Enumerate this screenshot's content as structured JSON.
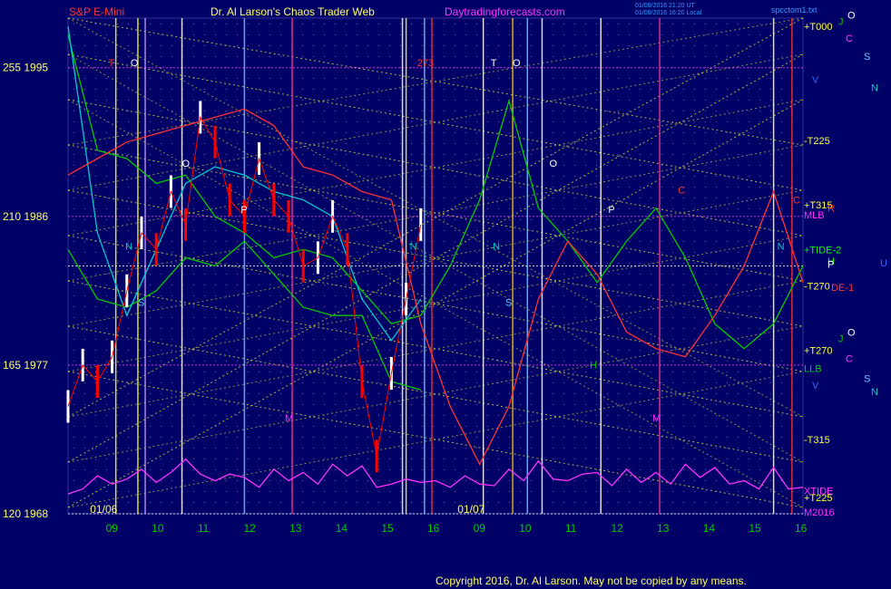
{
  "header": {
    "symbol": "S&P E-Mini",
    "title": "Dr. Al Larson's Chaos Trader Web",
    "site": "Daytradingforecasts.com",
    "stamp1": "01/08/2016 21:20 UT",
    "stamp2": "01/08/2016 16:20 Local",
    "chart_file": "spcctom1.txt"
  },
  "footer": {
    "copyright": "Copyright 2016, Dr. Al Larson. May not be copied by any means."
  },
  "colors": {
    "background": "#000066",
    "price_bar": "#ffffff",
    "price_down": "#ff0000",
    "green_line": "#00cc00",
    "cyan_line": "#00cccc",
    "red_line": "#ff3333",
    "magenta_line": "#ff33ff",
    "yellow_grid": "#ffff33"
  },
  "chart_data": {
    "type": "line",
    "title": "S&P E-Mini",
    "y_axis": {
      "ylim": [
        1968,
        1998
      ],
      "ticks": [
        {
          "price": 1995,
          "label": "255  1995"
        },
        {
          "price": 1986,
          "label": "210  1986"
        },
        {
          "price": 1977,
          "label": "165  1977"
        },
        {
          "price": 1968,
          "label": "120  1968"
        }
      ]
    },
    "x_axis": {
      "date_labels": [
        "01/06",
        "01/07"
      ],
      "hours_day1": [
        "09",
        "10",
        "11",
        "12",
        "13",
        "14",
        "15",
        "16"
      ],
      "hours_day2": [
        "09",
        "10",
        "11",
        "12",
        "13",
        "14",
        "15",
        "16"
      ]
    },
    "right_labels": [
      {
        "text": "+T000",
        "color": "#ffff33",
        "price": 1997.5
      },
      {
        "text": "J",
        "color": "#00cc00",
        "price": 1997.8
      },
      {
        "text": "O",
        "color": "#ffffff",
        "price": 1998.2
      },
      {
        "text": "C",
        "color": "#ff33ff",
        "price": 1996.8
      },
      {
        "text": "S",
        "color": "#66ccff",
        "price": 1995.7
      },
      {
        "text": "V",
        "color": "#3366ff",
        "price": 1994.3
      },
      {
        "text": "N",
        "color": "#00cccc",
        "price": 1993.8
      },
      {
        "text": "-T225",
        "color": "#ffff33",
        "price": 1990.6
      },
      {
        "text": "+T315",
        "color": "#ffff33",
        "price": 1986.7
      },
      {
        "text": "C",
        "color": "#ff3333",
        "price": 1987.0
      },
      {
        "text": "R",
        "color": "#ff3333",
        "price": 1986.5
      },
      {
        "text": "MLB",
        "color": "#ff33ff",
        "price": 1986.1
      },
      {
        "text": "+TIDE-2",
        "color": "#00ff00",
        "price": 1984.0
      },
      {
        "text": "H",
        "color": "#00ff00",
        "price": 1983.3
      },
      {
        "text": "P",
        "color": "#ffffff",
        "price": 1983.1
      },
      {
        "text": "U",
        "color": "#3366ff",
        "price": 1983.2
      },
      {
        "text": "-T270",
        "color": "#ffff33",
        "price": 1981.8
      },
      {
        "text": "DE-1",
        "color": "#ff3333",
        "price": 1981.7
      },
      {
        "text": "J",
        "color": "#00cc00",
        "price": 1978.6
      },
      {
        "text": "O",
        "color": "#ffffff",
        "price": 1979.0
      },
      {
        "text": "+T270",
        "color": "#ffff33",
        "price": 1977.9
      },
      {
        "text": "C",
        "color": "#ff33ff",
        "price": 1977.4
      },
      {
        "text": "LLB",
        "color": "#00cc00",
        "price": 1976.8
      },
      {
        "text": "S",
        "color": "#66ccff",
        "price": 1976.2
      },
      {
        "text": "V",
        "color": "#3366ff",
        "price": 1975.8
      },
      {
        "text": "N",
        "color": "#00cccc",
        "price": 1975.4
      },
      {
        "text": "-T315",
        "color": "#ffff33",
        "price": 1972.5
      },
      {
        "text": "XTIDE",
        "color": "#ff33ff",
        "price": 1969.4
      },
      {
        "text": "+T225",
        "color": "#ffff33",
        "price": 1969.0
      },
      {
        "text": "M2016",
        "color": "#ff33ff",
        "price": 1968.1
      }
    ],
    "in_chart_labels": [
      {
        "text": "T",
        "color": "#ff3333",
        "x": 0.055,
        "price": 1995.1
      },
      {
        "text": "O",
        "color": "#ffffff",
        "x": 0.085,
        "price": 1995.1
      },
      {
        "text": "273",
        "color": "#ff3333",
        "x": 0.475,
        "price": 1995.1
      },
      {
        "text": "T",
        "color": "#ffffff",
        "x": 0.575,
        "price": 1995.1
      },
      {
        "text": "O",
        "color": "#ffffff",
        "x": 0.605,
        "price": 1995.1
      },
      {
        "text": "O",
        "color": "#ffffff",
        "x": 0.155,
        "price": 1989.0
      },
      {
        "text": "O",
        "color": "#ffffff",
        "x": 0.655,
        "price": 1989.0
      },
      {
        "text": "P",
        "color": "#ffffff",
        "x": 0.235,
        "price": 1986.2
      },
      {
        "text": "P",
        "color": "#ffffff",
        "x": 0.735,
        "price": 1986.2
      },
      {
        "text": "N",
        "color": "#00cccc",
        "x": 0.078,
        "price": 1984.0
      },
      {
        "text": "N",
        "color": "#00cccc",
        "x": 0.465,
        "price": 1984.0
      },
      {
        "text": "N",
        "color": "#00cccc",
        "x": 0.578,
        "price": 1984.0
      },
      {
        "text": "N",
        "color": "#00cccc",
        "x": 0.965,
        "price": 1984.0
      },
      {
        "text": "S",
        "color": "#66ccff",
        "x": 0.095,
        "price": 1980.6
      },
      {
        "text": "S",
        "color": "#66ccff",
        "x": 0.595,
        "price": 1980.6
      },
      {
        "text": "M",
        "color": "#ff33ff",
        "x": 0.295,
        "price": 1973.6
      },
      {
        "text": "M",
        "color": "#ff33ff",
        "x": 0.795,
        "price": 1973.6
      },
      {
        "text": "H",
        "color": "#00cc00",
        "x": 0.71,
        "price": 1976.8
      },
      {
        "text": "C",
        "color": "#ff3333",
        "x": 0.83,
        "price": 1987.4
      }
    ],
    "series": [
      {
        "name": "price_close",
        "color": "#ffffff",
        "x": [
          0.0,
          0.02,
          0.04,
          0.06,
          0.08,
          0.1,
          0.12,
          0.14,
          0.16,
          0.18,
          0.2,
          0.22,
          0.24,
          0.26,
          0.28,
          0.3,
          0.32,
          0.34,
          0.36,
          0.38,
          0.4,
          0.42,
          0.44,
          0.46,
          0.48
        ],
        "y": [
          1974.5,
          1977.0,
          1976.0,
          1977.5,
          1981.5,
          1985.0,
          1984.0,
          1987.5,
          1985.5,
          1992.0,
          1990.5,
          1987.0,
          1986.0,
          1989.5,
          1987.0,
          1986.0,
          1983.0,
          1983.5,
          1986.0,
          1984.0,
          1976.0,
          1971.5,
          1976.5,
          1981.0,
          1985.5
        ]
      },
      {
        "name": "green_a",
        "color": "#00cc00",
        "x": [
          0.0,
          0.04,
          0.08,
          0.12,
          0.16,
          0.2,
          0.24,
          0.28,
          0.32,
          0.36,
          0.4,
          0.44,
          0.48,
          0.52,
          0.56,
          0.6,
          0.64,
          0.68,
          0.72,
          0.76,
          0.8,
          0.84,
          0.88,
          0.92,
          0.96,
          1.0
        ],
        "y": [
          1997.0,
          1990.0,
          1989.5,
          1988.0,
          1988.5,
          1986.0,
          1985.0,
          1983.5,
          1984.0,
          1983.5,
          1981.5,
          1979.5,
          1980.0,
          1983.0,
          1987.0,
          1993.0,
          1986.5,
          1984.5,
          1982.0,
          1984.5,
          1986.5,
          1983.5,
          1979.5,
          1978.0,
          1979.5,
          1983.0
        ]
      },
      {
        "name": "green_b",
        "color": "#00cc00",
        "x": [
          0.0,
          0.04,
          0.08,
          0.12,
          0.16,
          0.2,
          0.24,
          0.28,
          0.32,
          0.36,
          0.4,
          0.44,
          0.48
        ],
        "y": [
          1984.0,
          1981.0,
          1980.5,
          1981.5,
          1983.5,
          1983.0,
          1984.5,
          1982.5,
          1980.5,
          1980.0,
          1980.0,
          1976.0,
          1975.5
        ]
      },
      {
        "name": "cyan_avg",
        "color": "#00cccc",
        "x": [
          0.0,
          0.04,
          0.08,
          0.12,
          0.16,
          0.2,
          0.24,
          0.28,
          0.32,
          0.36,
          0.4,
          0.44,
          0.48
        ],
        "y": [
          1997.5,
          1985.0,
          1980.0,
          1984.0,
          1988.0,
          1989.0,
          1988.5,
          1987.5,
          1987.0,
          1986.0,
          1981.0,
          1978.5,
          1981.0
        ]
      },
      {
        "name": "red_a",
        "color": "#ff3333",
        "x": [
          0.0,
          0.04,
          0.08,
          0.12,
          0.16,
          0.2,
          0.24,
          0.28,
          0.32,
          0.36,
          0.4,
          0.44,
          0.48,
          0.52,
          0.56,
          0.6,
          0.64,
          0.68,
          0.72,
          0.76,
          0.8,
          0.84,
          0.88,
          0.92,
          0.96,
          1.0
        ],
        "y": [
          1988.5,
          1989.5,
          1990.5,
          1991.0,
          1991.5,
          1992.0,
          1992.5,
          1991.5,
          1989.0,
          1988.5,
          1987.5,
          1987.0,
          1979.5,
          1974.5,
          1971.0,
          1974.5,
          1981.0,
          1984.5,
          1982.5,
          1979.0,
          1978.0,
          1977.5,
          1980.0,
          1983.0,
          1987.5,
          1982.0
        ]
      },
      {
        "name": "magenta_tide",
        "color": "#ff33ff",
        "x": [
          0.0,
          0.02,
          0.04,
          0.06,
          0.08,
          0.1,
          0.12,
          0.14,
          0.16,
          0.18,
          0.2,
          0.22,
          0.24,
          0.26,
          0.28,
          0.3,
          0.32,
          0.34,
          0.36,
          0.38,
          0.4,
          0.42,
          0.44,
          0.46,
          0.48,
          0.5,
          0.52,
          0.54,
          0.56,
          0.58,
          0.6,
          0.62,
          0.64,
          0.66,
          0.68,
          0.7,
          0.72,
          0.74,
          0.76,
          0.78,
          0.8,
          0.82,
          0.84,
          0.86,
          0.88,
          0.9,
          0.92,
          0.94,
          0.96,
          0.98,
          1.0
        ],
        "y": [
          1969.2,
          1969.5,
          1970.3,
          1969.8,
          1970.1,
          1970.7,
          1969.9,
          1970.5,
          1971.3,
          1970.4,
          1970.0,
          1970.4,
          1970.2,
          1969.6,
          1970.7,
          1970.0,
          1970.5,
          1969.8,
          1971.0,
          1970.3,
          1970.9,
          1969.6,
          1969.8,
          1970.1,
          1969.9,
          1970.0,
          1969.6,
          1970.3,
          1969.8,
          1969.7,
          1970.7,
          1970.0,
          1971.2,
          1970.1,
          1970.0,
          1970.4,
          1970.5,
          1969.7,
          1970.7,
          1969.9,
          1970.5,
          1969.8,
          1971.0,
          1970.2,
          1970.8,
          1969.8,
          1970.0,
          1969.5,
          1970.8,
          1969.5,
          1969.6
        ]
      }
    ],
    "hlines": [
      {
        "price": 1995,
        "color": "#ff33ff"
      },
      {
        "price": 1986,
        "color": "#ff33ff"
      },
      {
        "price": 1977,
        "color": "#ff33ff"
      },
      {
        "price": 1983,
        "color": "#ffffff"
      },
      {
        "price": 1968,
        "color": "#ffffff"
      }
    ],
    "vlines": [
      {
        "x": 0.065,
        "color": "#ffff33"
      },
      {
        "x": 0.095,
        "color": "#ffff33"
      },
      {
        "x": 0.105,
        "color": "#cc99ff"
      },
      {
        "x": 0.155,
        "color": "#ffffff"
      },
      {
        "x": 0.24,
        "color": "#66ccff"
      },
      {
        "x": 0.305,
        "color": "#ff3399"
      },
      {
        "x": 0.455,
        "color": "#ffffff"
      },
      {
        "x": 0.46,
        "color": "#ffff33"
      },
      {
        "x": 0.485,
        "color": "#66ccff"
      },
      {
        "x": 0.495,
        "color": "#ff3333"
      },
      {
        "x": 0.565,
        "color": "#ffffff"
      },
      {
        "x": 0.605,
        "color": "#ffcc00"
      },
      {
        "x": 0.625,
        "color": "#66ccff"
      },
      {
        "x": 0.645,
        "color": "#ffffff"
      },
      {
        "x": 0.725,
        "color": "#ffffff"
      },
      {
        "x": 0.805,
        "color": "#ff3399"
      },
      {
        "x": 0.96,
        "color": "#ffffff"
      },
      {
        "x": 0.985,
        "color": "#ff3333"
      }
    ]
  }
}
